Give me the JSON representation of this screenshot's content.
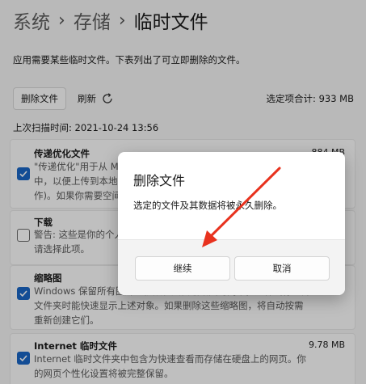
{
  "breadcrumb": {
    "items": [
      "系统",
      "存储",
      "临时文件"
    ],
    "separator": "›"
  },
  "description": "应用需要某些临时文件。下表列出了可立即删除的文件。",
  "toolbar": {
    "delete_label": "删除文件",
    "refresh_label": "刷新",
    "total_label": "选定项合计: 933 MB"
  },
  "last_scan": "上次扫描时间: 2021-10-24 13:56",
  "items": [
    {
      "title": "传递优化文件",
      "size": "884 MB",
      "checked": true,
      "lines": [
        "\"传递优化\"用于从 Microsoft 下载更新。如果你的网络连接速度较慢，可删",
        "中，以便上传到本地网络中的其他电脑。你可以在不需要时删除",
        "作)。如果你需要空间，可以在此处删除。"
      ]
    },
    {
      "title": "下载",
      "size": "",
      "checked": false,
      "lines": [
        "警告: 这些是你的个人下载文件夹中的文件。如果你不确定，",
        "请选择此项。"
      ]
    },
    {
      "title": "缩略图",
      "size": "",
      "checked": true,
      "lines": [
        "Windows 保留所有图片、视频和文档缩略图的副本，这样当你打开",
        "文件夹时能快速显示上述对象。如果删除这些缩略图，将自动按需",
        "重新创建它们。"
      ]
    },
    {
      "title": "Internet 临时文件",
      "size": "9.78 MB",
      "checked": true,
      "lines": [
        "Internet 临时文件夹中包含为快速查看而存储在硬盘上的网页。你",
        "的网页个性化设置将被完整保留。"
      ]
    }
  ],
  "dialog": {
    "title": "删除文件",
    "message": "选定的文件及其数据将被永久删除。",
    "continue_label": "继续",
    "cancel_label": "取消"
  },
  "colors": {
    "accent": "#1a66c4",
    "annotation_arrow": "#e8321e"
  }
}
